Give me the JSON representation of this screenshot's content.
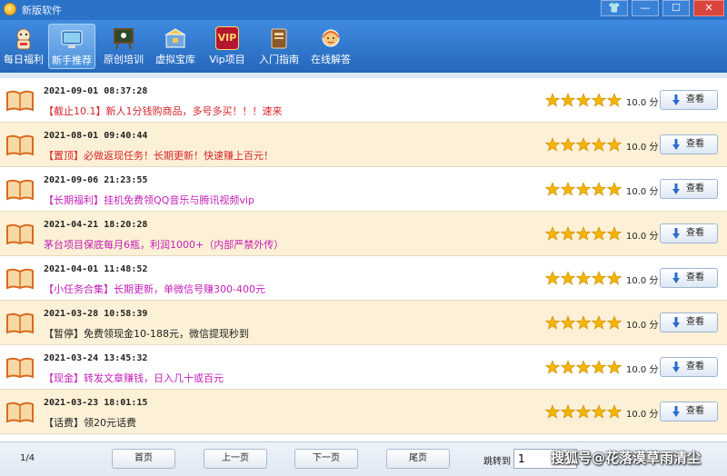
{
  "window": {
    "title": "新版软件",
    "buttons": [
      "👕",
      "—",
      "☐",
      "✕"
    ]
  },
  "toolbar": {
    "items": [
      {
        "label": "每日福利",
        "icon": "lucky-cat-icon",
        "color": "#f6e5c7"
      },
      {
        "label": "新手推荐",
        "icon": "monitor-icon",
        "color": "#8fd0f2"
      },
      {
        "label": "原创培训",
        "icon": "blackboard-icon",
        "color": "#6b4a2a"
      },
      {
        "label": "虚拟宝库",
        "icon": "treasure-box-icon",
        "color": "#6fa8dc"
      },
      {
        "label": "Vip项目",
        "icon": "vip-icon",
        "color": "#b4162f",
        "badge": "VIP"
      },
      {
        "label": "入门指南",
        "icon": "book-guide-icon",
        "color": "#8a5a2c"
      },
      {
        "label": "在线解答",
        "icon": "support-agent-icon",
        "color": "#f7c97a"
      }
    ]
  },
  "list": {
    "rows": [
      {
        "date": "2021-09-01 08:37:28",
        "title": "【截止10.1】新人1分钱购商品，多号多买！！！速来",
        "color": "#d6262b",
        "rating": 5,
        "score": "10.0 分",
        "button": "查看"
      },
      {
        "date": "2021-08-01 09:40:44",
        "title": "【置顶】必做返现任务！长期更新！快速赚上百元！",
        "color": "#d6262b",
        "rating": 5,
        "score": "10.0 分",
        "button": "查看"
      },
      {
        "date": "2021-09-06 21:23:55",
        "title": "【长期福利】挂机免费领QQ音乐与腾讯视频vip",
        "color": "#c41fb8",
        "rating": 5,
        "score": "10.0 分",
        "button": "查看"
      },
      {
        "date": "2021-04-21 18:20:28",
        "title": "茅台项目保底每月6瓶，利润1000+（内部严禁外传）",
        "color": "#c41fb8",
        "rating": 5,
        "score": "10.0 分",
        "button": "查看"
      },
      {
        "date": "2021-04-01 11:48:52",
        "title": "【小任务合集】长期更新，单微信号赚300-400元",
        "color": "#c41fb8",
        "rating": 5,
        "score": "10.0 分",
        "button": "查看"
      },
      {
        "date": "2021-03-28 10:58:39",
        "title": "【暂停】免费领现金10-188元，微信提现秒到",
        "color": "#222222",
        "rating": 5,
        "score": "10.0 分",
        "button": "查看"
      },
      {
        "date": "2021-03-24 13:45:32",
        "title": "【现金】转发文章赚钱，日入几十或百元",
        "color": "#c41fb8",
        "rating": 5,
        "score": "10.0 分",
        "button": "查看"
      },
      {
        "date": "2021-03-23 18:01:15",
        "title": "【话费】领20元话费",
        "color": "#222222",
        "rating": 5,
        "score": "10.0 分",
        "button": "查看"
      }
    ]
  },
  "footer": {
    "page_info": "1/4",
    "first": "首页",
    "prev": "上一页",
    "next": "下一页",
    "last": "尾页",
    "jump_label": "跳转到",
    "jump_value": "1"
  },
  "watermark": "搜狐号@花落漠草雨清尘",
  "colors": {
    "titlebar": "#2b73c9",
    "toolbar": "#2f74c8",
    "row_alt": "#fcf0d6",
    "star": "#f5b400"
  }
}
